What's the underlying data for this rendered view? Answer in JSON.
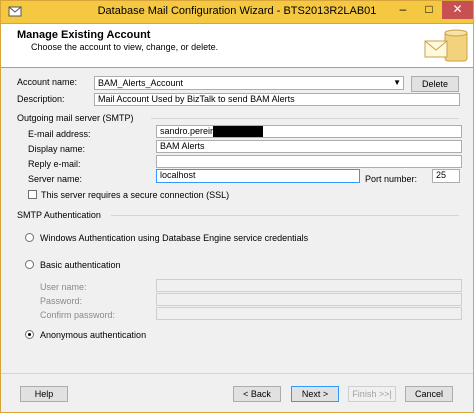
{
  "window": {
    "title": "Database Mail Configuration Wizard - BTS2013R2LAB01",
    "min_glyph": "–",
    "max_glyph": "□",
    "close_glyph": "✕"
  },
  "header": {
    "title": "Manage Existing Account",
    "subtitle": "Choose the account to view, change, or delete."
  },
  "account": {
    "name_label": "Account name:",
    "name_value": "BAM_Alerts_Account",
    "delete_label": "Delete",
    "description_label": "Description:",
    "description_value": "Mail Account Used by BizTalk to send BAM Alerts"
  },
  "smtp": {
    "group_label": "Outgoing mail server (SMTP)",
    "email_label": "E-mail address:",
    "email_value": "sandro.pereira@",
    "display_label": "Display name:",
    "display_value": "BAM Alerts",
    "reply_label": "Reply e-mail:",
    "reply_value": "",
    "server_label": "Server name:",
    "server_value": "localhost",
    "port_label": "Port number:",
    "port_value": "25",
    "ssl_label": "This server requires a secure connection (SSL)"
  },
  "auth": {
    "group_label": "SMTP Authentication",
    "windows_label": "Windows Authentication using Database Engine service credentials",
    "basic_label": "Basic authentication",
    "user_label": "User name:",
    "password_label": "Password:",
    "confirm_label": "Confirm password:",
    "anonymous_label": "Anonymous authentication"
  },
  "footer": {
    "help": "Help",
    "back": "< Back",
    "next": "Next >",
    "finish": "Finish >>|",
    "cancel": "Cancel"
  }
}
